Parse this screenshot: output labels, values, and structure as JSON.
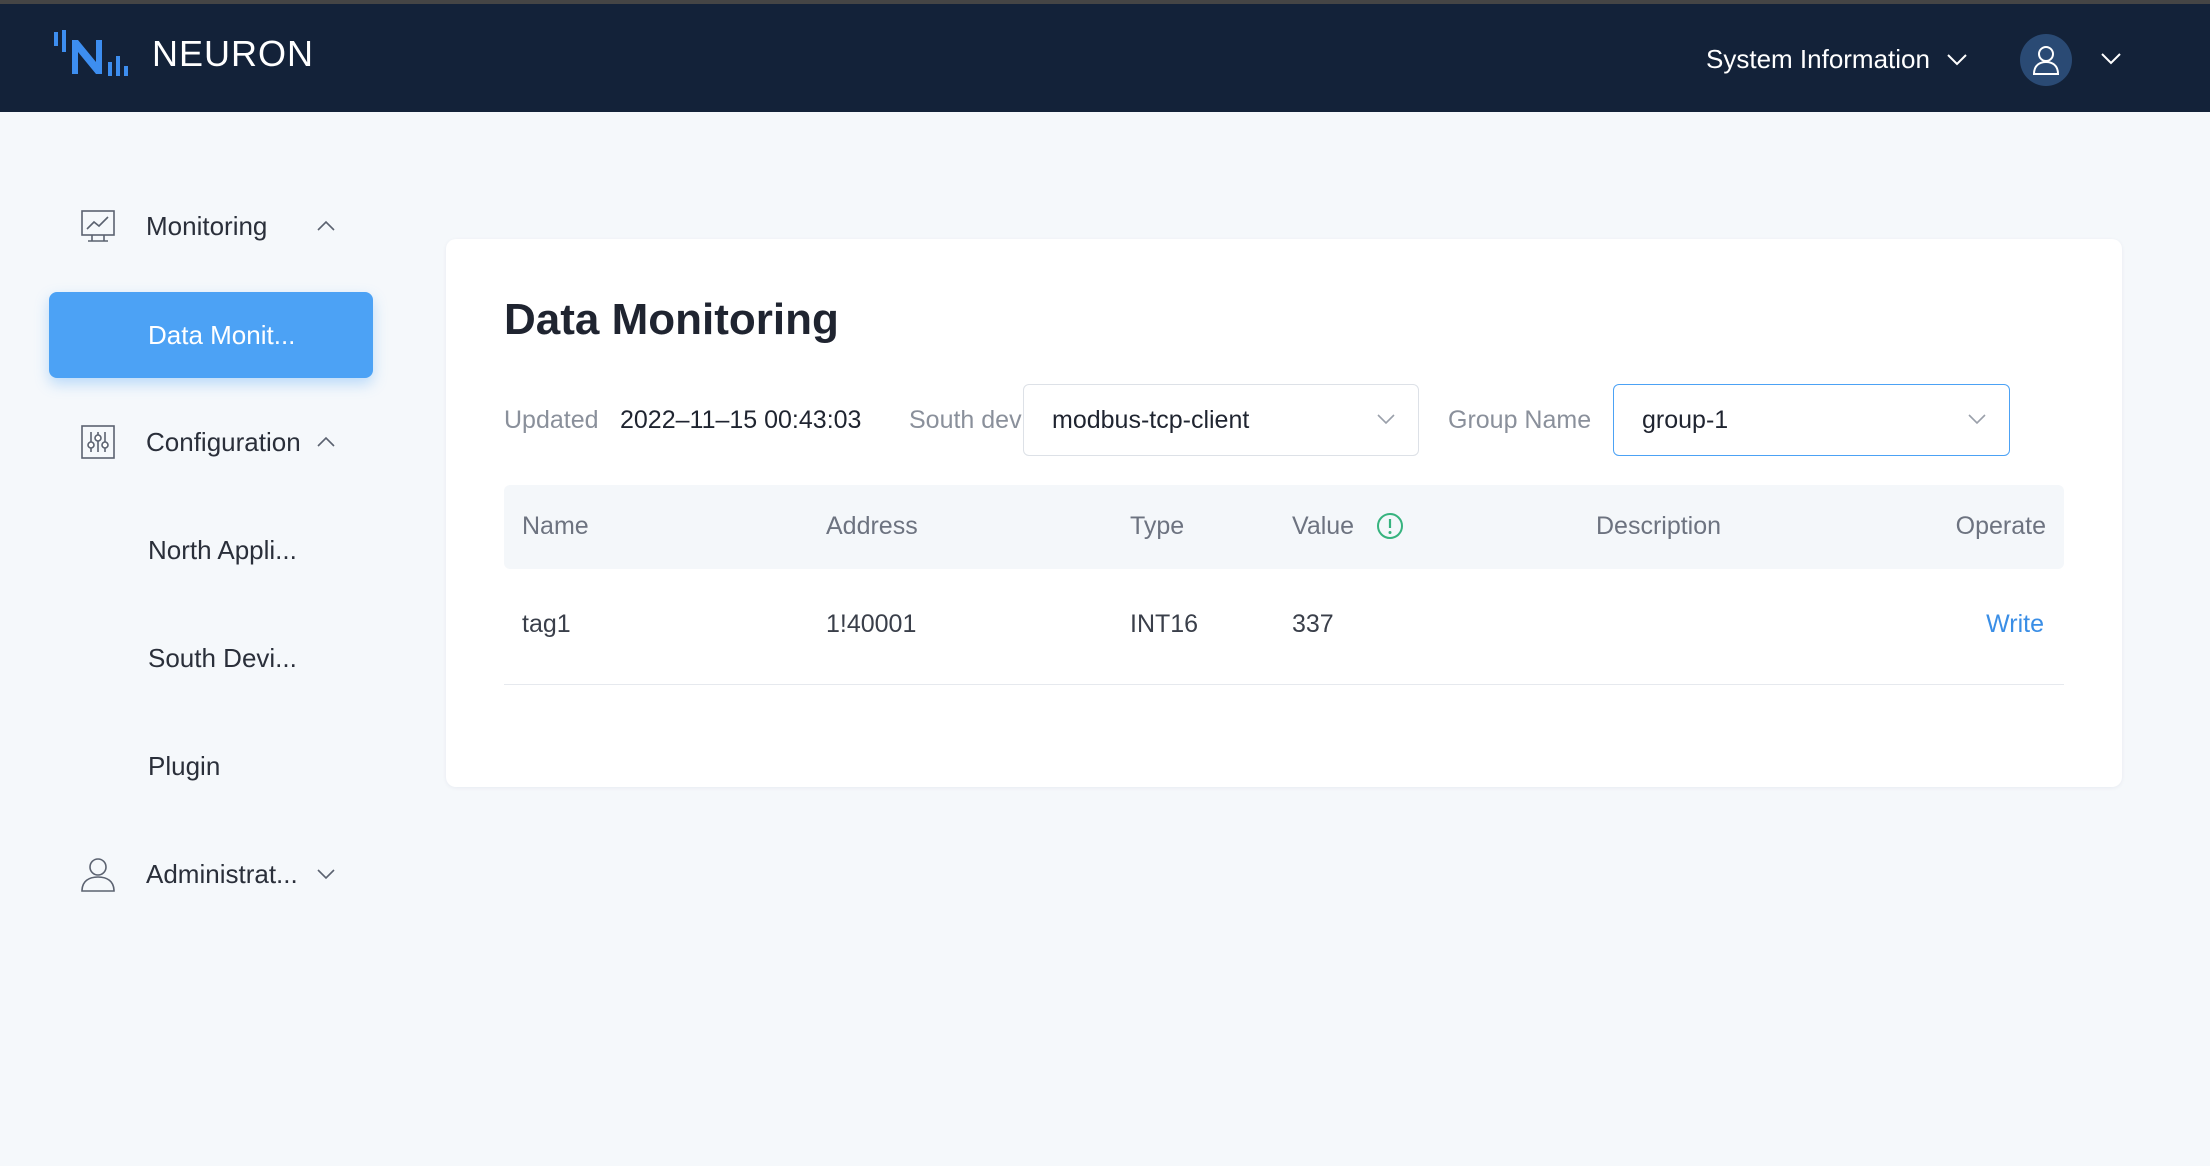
{
  "header": {
    "brand": "NEURON",
    "system_info_label": "System Information"
  },
  "sidebar": {
    "groups": [
      {
        "label": "Monitoring",
        "icon": "monitor-chart-icon",
        "expanded": true,
        "items": [
          {
            "label": "Data Monit...",
            "active": true
          }
        ]
      },
      {
        "label": "Configuration",
        "icon": "sliders-icon",
        "expanded": true,
        "items": [
          {
            "label": "North Appli..."
          },
          {
            "label": "South Devi..."
          },
          {
            "label": "Plugin"
          }
        ]
      },
      {
        "label": "Administrat...",
        "icon": "user-icon",
        "expanded": false,
        "items": []
      }
    ]
  },
  "main": {
    "title": "Data Monitoring",
    "updated_label": "Updated",
    "updated_value": "2022–11–15 00:43:03",
    "south_device_label": "South device",
    "south_device_value": "modbus-tcp-client",
    "group_name_label": "Group Name",
    "group_name_value": "group-1",
    "table": {
      "columns": [
        "Name",
        "Address",
        "Type",
        "Value",
        "Description",
        "Operate"
      ],
      "rows": [
        {
          "name": "tag1",
          "address": "1!40001",
          "type": "INT16",
          "value": "337",
          "description": "",
          "operate": "Write"
        }
      ]
    }
  },
  "colors": {
    "header_bg": "#132239",
    "accent": "#4ca2f5",
    "link": "#3a8ee6",
    "info_icon": "#36b37e"
  }
}
